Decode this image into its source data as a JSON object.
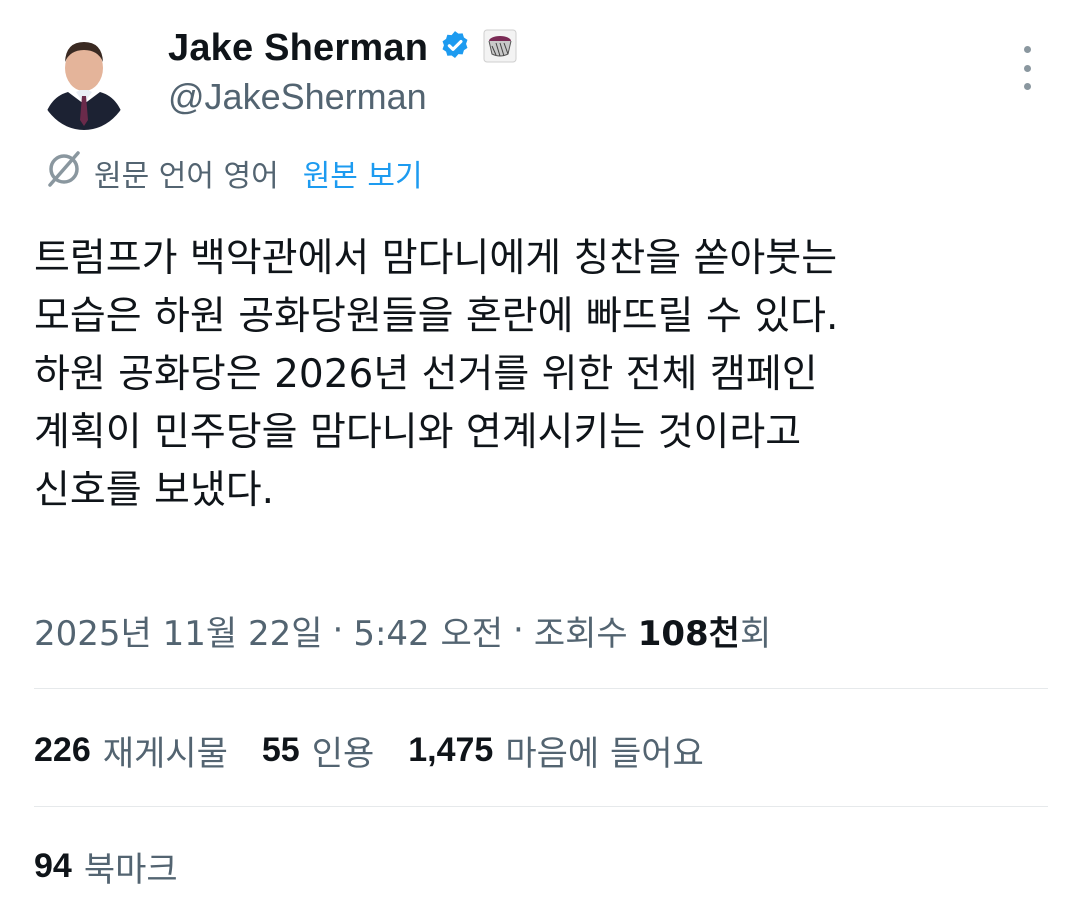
{
  "author": {
    "display_name": "Jake Sherman",
    "handle": "@JakeSherman",
    "verified": true
  },
  "translation": {
    "label": "원문 언어 영어",
    "show_original": "원본 보기"
  },
  "tweet": {
    "lines": [
      "트럼프가 백악관에서 맘다니에게 칭찬을 쏟아붓는",
      "모습은 하원 공화당원들을 혼란에 빠뜨릴 수 있다.",
      "하원 공화당은 2026년 선거를 위한 전체 캠페인",
      "계획이 민주당을 맘다니와 연계시키는 것이라고",
      "신호를 보냈다."
    ]
  },
  "meta": {
    "date": "2025년 11월 22일",
    "separator": "·",
    "time": "5:42 오전",
    "views_label": "조회수",
    "views_count": "108천",
    "views_suffix": "회"
  },
  "stats": {
    "reposts_count": "226",
    "reposts_label": "재게시물",
    "quotes_count": "55",
    "quotes_label": "인용",
    "likes_count": "1,475",
    "likes_label": "마음에 들어요",
    "bookmarks_count": "94",
    "bookmarks_label": "북마크"
  },
  "colors": {
    "accent": "#1d9bf0",
    "text_primary": "#0f1419",
    "text_secondary": "#536471"
  },
  "icons": {
    "verified": "verified-badge-icon",
    "emoji": "drum-emoji-icon",
    "translate": "translate-icon",
    "more": "more-vertical-icon"
  }
}
